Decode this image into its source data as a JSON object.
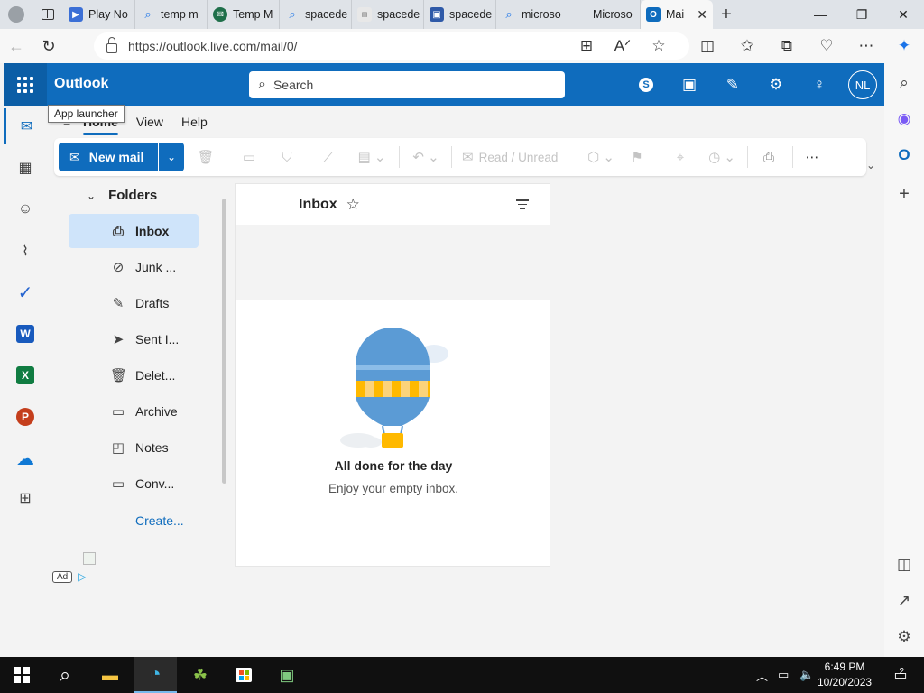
{
  "browser": {
    "tabs": [
      {
        "label": "Play No",
        "icon": "play-icon",
        "color": "#3b6fd6"
      },
      {
        "label": "temp m",
        "icon": "search-icon",
        "color": "#1a73e8"
      },
      {
        "label": "Temp M",
        "icon": "temp-mail-icon",
        "color": "#1f6f4a"
      },
      {
        "label": "spacede",
        "icon": "search-icon",
        "color": "#1a73e8"
      },
      {
        "label": "spacede",
        "icon": "spacedesk-icon",
        "color": "#888888"
      },
      {
        "label": "spacede",
        "icon": "spacedesk-blue-icon",
        "color": "#2f5aa8"
      },
      {
        "label": "microso",
        "icon": "search-icon",
        "color": "#1a73e8"
      },
      {
        "label": "Microso",
        "icon": "microsoft-logo-icon",
        "color": "#f25022"
      },
      {
        "label": "Mai",
        "icon": "outlook-icon",
        "color": "#0f6cbd",
        "active": true
      }
    ],
    "url": "https://outlook.live.com/mail/0/"
  },
  "outlook": {
    "brand": "Outlook",
    "search_placeholder": "Search",
    "avatar_initials": "NL",
    "tooltip": "App launcher",
    "ribbon_tabs": [
      "Home",
      "View",
      "Help"
    ],
    "toolbar": {
      "new_mail": "New mail",
      "read_unread": "Read / Unread"
    },
    "folders_header": "Folders",
    "folders": [
      {
        "label": "Inbox",
        "icon": "inbox-icon",
        "active": true
      },
      {
        "label": "Junk ...",
        "icon": "junk-icon"
      },
      {
        "label": "Drafts",
        "icon": "drafts-icon"
      },
      {
        "label": "Sent I...",
        "icon": "sent-icon"
      },
      {
        "label": "Delet...",
        "icon": "trash-icon"
      },
      {
        "label": "Archive",
        "icon": "archive-icon"
      },
      {
        "label": "Notes",
        "icon": "notes-icon"
      },
      {
        "label": "Conv...",
        "icon": "folder-icon"
      }
    ],
    "create_link": "Create...",
    "ad_badge": "Ad",
    "inbox_title": "Inbox",
    "empty_title": "All done for the day",
    "empty_subtitle": "Enjoy your empty inbox."
  },
  "taskbar": {
    "time": "6:49 PM",
    "date": "10/20/2023",
    "notification_count": "2"
  },
  "colors": {
    "accent": "#0f6cbd",
    "selected_folder": "#cfe4fa"
  }
}
